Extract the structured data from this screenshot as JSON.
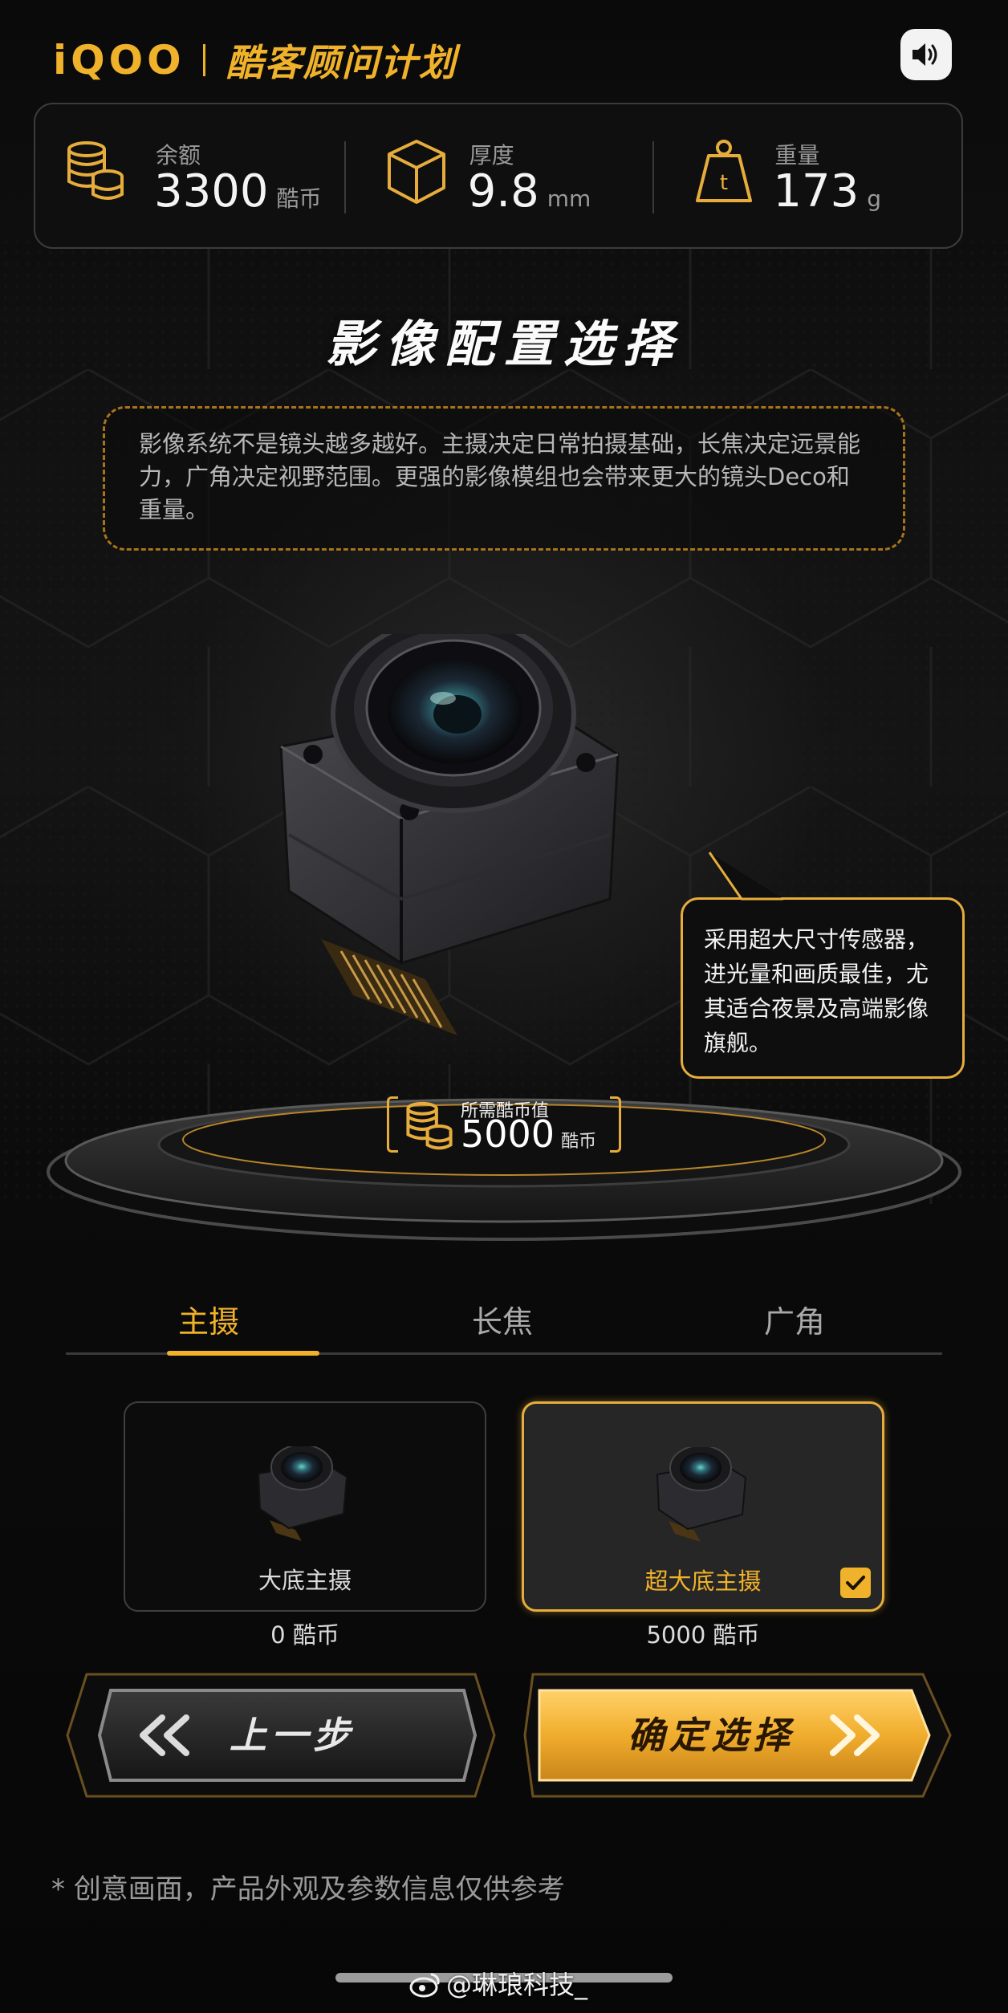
{
  "header": {
    "brand": "iQOO",
    "program_title": "酷客顾问计划",
    "sound_icon": "speaker-icon"
  },
  "stats": [
    {
      "label": "余额",
      "value": "3300",
      "unit": "酷币",
      "icon": "coins-icon"
    },
    {
      "label": "厚度",
      "value": "9.8",
      "unit": "mm",
      "icon": "cube-icon"
    },
    {
      "label": "重量",
      "value": "173",
      "unit": "g",
      "icon": "weight-icon"
    }
  ],
  "section": {
    "title": "影像配置选择",
    "description": "影像系统不是镜头越多越好。主摄决定日常拍摄基础，长焦决定远景能力，广角决定视野范围。更强的影像模组也会带来更大的镜头Deco和重量。"
  },
  "callout": {
    "text": "采用超大尺寸传感器，进光量和画质最佳，尤其适合夜景及高端影像旗舰。"
  },
  "cost": {
    "label": "所需酷币值",
    "value": "5000",
    "unit": "酷币"
  },
  "tabs": [
    {
      "label": "主摄",
      "active": true
    },
    {
      "label": "长焦",
      "active": false
    },
    {
      "label": "广角",
      "active": false
    }
  ],
  "options": [
    {
      "name": "大底主摄",
      "price": "0 酷币",
      "selected": false
    },
    {
      "name": "超大底主摄",
      "price": "5000 酷币",
      "selected": true
    }
  ],
  "buttons": {
    "prev_label": "上一步",
    "confirm_label": "确定选择"
  },
  "disclaimer": "* 创意画面，产品外观及参数信息仅供参考",
  "watermark": "@琳琅科技_",
  "colors": {
    "accent": "#f0b22a",
    "background": "#0a0a0a",
    "panel_border": "#3b3b3b"
  }
}
